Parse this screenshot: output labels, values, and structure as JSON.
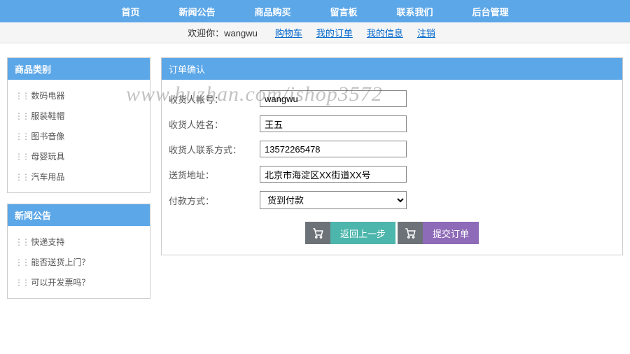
{
  "topnav": {
    "home": "首页",
    "news": "新闻公告",
    "shop": "商品购买",
    "guestbook": "留言板",
    "contact": "联系我们",
    "admin": "后台管理"
  },
  "subnav": {
    "welcome_prefix": "欢迎你：",
    "username": "wangwu",
    "cart": "购物车",
    "orders": "我的订单",
    "profile": "我的信息",
    "logout": "注销"
  },
  "sidebar": {
    "categories": {
      "title": "商品类别",
      "items": [
        "数码电器",
        "服装鞋帽",
        "图书音像",
        "母婴玩具",
        "汽车用品"
      ]
    },
    "news": {
      "title": "新闻公告",
      "items": [
        "快递支持",
        "能否送货上门？",
        "可以开发票吗？"
      ]
    }
  },
  "main": {
    "title": "订单确认",
    "form": {
      "account_label": "收货人帐号：",
      "account_value": "wangwu",
      "name_label": "收货人姓名：",
      "name_value": "王五",
      "contact_label": "收货人联系方式：",
      "contact_value": "13572265478",
      "address_label": "送货地址：",
      "address_value": "北京市海淀区XX街道XX号",
      "payment_label": "付款方式：",
      "payment_value": "货到付款"
    },
    "buttons": {
      "back": "返回上一步",
      "submit": "提交订单"
    }
  },
  "watermark": "www.huzhan.com/ishop3572"
}
